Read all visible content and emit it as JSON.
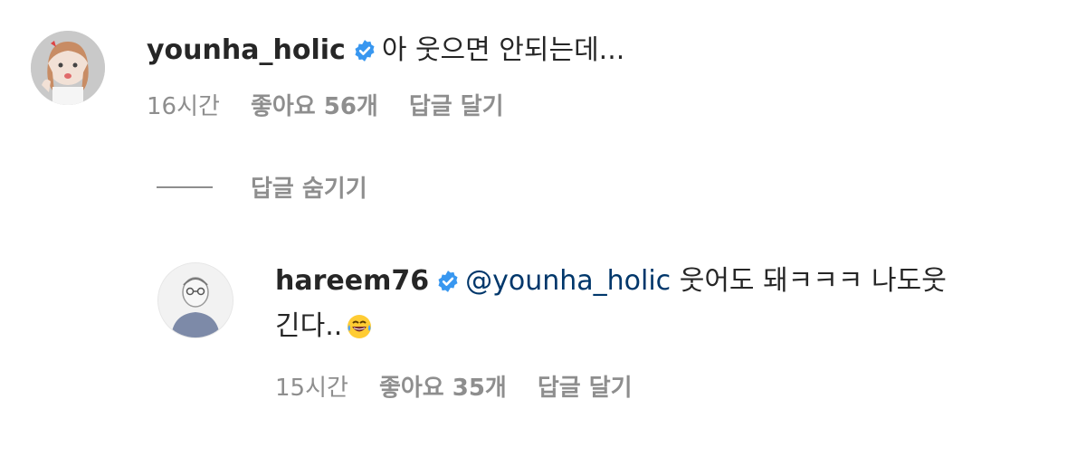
{
  "comments": [
    {
      "username": "younha_holic",
      "text": "아 웃으면 안되는데...",
      "time": "16시간",
      "likes": "좋아요 56개",
      "reply_label": "답글 달기"
    }
  ],
  "hide_replies_label": "답글 숨기기",
  "reply": {
    "username": "hareem76",
    "mention": "@younha_holic",
    "text_line1": "웃어도 돼ㅋㅋㅋ 나도웃",
    "text_line2": "긴다..",
    "time": "15시간",
    "likes": "좋아요 35개",
    "reply_label": "답글 달기"
  },
  "colors": {
    "verified": "#3897f0",
    "mention": "#00376b",
    "meta": "#8e8e8e"
  },
  "icons": [
    "verified-badge-icon",
    "laughing-emoji-icon"
  ]
}
